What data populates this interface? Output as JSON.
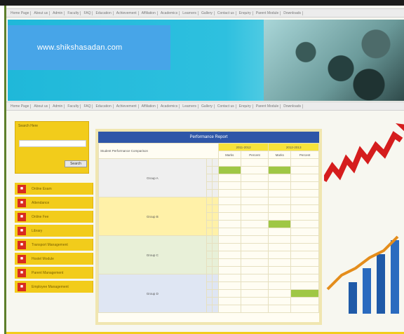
{
  "header": {
    "site_url": "www.shikshasadan.com",
    "top_nav": [
      "Home Page",
      "About us",
      "Admin",
      "Faculty",
      "FAQ",
      "Education",
      "Achievement",
      "Affiliation",
      "Academics",
      "Learners",
      "Gallery",
      "Contact us",
      "Enquiry",
      "Parent Module",
      "Downloads"
    ],
    "mid_nav": [
      "Home Page",
      "About us",
      "Admin",
      "Faculty",
      "FAQ",
      "Education",
      "Achievement",
      "Affiliation",
      "Academics",
      "Learners",
      "Gallery",
      "Contact us",
      "Enquiry",
      "Parent Module",
      "Downloads"
    ]
  },
  "search": {
    "title": "Search Here",
    "placeholder": "",
    "button": "Search"
  },
  "menu": {
    "items": [
      "Online Exam",
      "Attendance",
      "Online Fee",
      "Library",
      "Transport Management",
      "Hostel Module",
      "Parent Management",
      "Employee Management"
    ]
  },
  "report": {
    "title": "Performance Report",
    "header_label": "Student Performance Comparison",
    "years": [
      "2011-2012",
      "2012-2013"
    ],
    "subcols": [
      "Marks",
      "Percent",
      "Marks",
      "Percent"
    ],
    "groups": [
      "Group A",
      "Group B",
      "Group C",
      "Group D"
    ]
  },
  "colors": {
    "accent": "#f2cc1b",
    "header_blue": "#2e56a8",
    "menu_red": "#d92b1f",
    "banner_cyan": "#1fb8d9",
    "frame_green": "#5e7f2c"
  }
}
